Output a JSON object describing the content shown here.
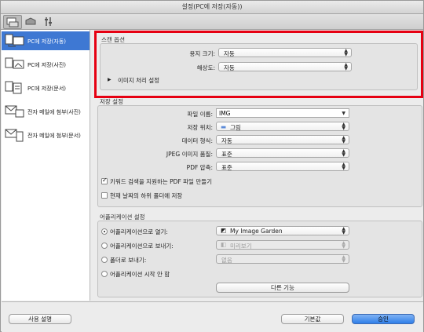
{
  "window": {
    "title": "설정(PC에 저장(자동))"
  },
  "toolbar": {
    "buttons": [
      "scan-from-computer-icon",
      "scan-from-panel-icon",
      "general-settings-icon"
    ]
  },
  "sidebar": {
    "items": [
      {
        "label": "PC에 저장(자동)",
        "icon": "save-auto-icon",
        "selected": true
      },
      {
        "label": "PC에 저장(사진)",
        "icon": "save-photo-icon"
      },
      {
        "label": "PC에 저장(문서)",
        "icon": "save-document-icon"
      },
      {
        "label": "전자 메일에 첨부(사진)",
        "icon": "email-photo-icon"
      },
      {
        "label": "전자 메일에 첨부(문서)",
        "icon": "email-document-icon"
      }
    ]
  },
  "scan_options": {
    "title": "스캔 옵션",
    "paper_size_label": "용지 크기:",
    "paper_size_value": "자동",
    "resolution_label": "해상도:",
    "resolution_value": "자동",
    "image_processing_label": "이미지 처리 설정"
  },
  "save_settings": {
    "title": "저장 설정",
    "file_name_label": "파일 이름:",
    "file_name_value": "IMG",
    "save_in_label": "저장 위치:",
    "save_in_value": "그림",
    "data_format_label": "데이터 형식:",
    "data_format_value": "자동",
    "jpeg_quality_label": "JPEG 이미지 품질:",
    "jpeg_quality_value": "표준",
    "pdf_compression_label": "PDF 압축:",
    "pdf_compression_value": "표준",
    "keyword_pdf_label": "키워드 검색을 지원하는 PDF 파일 만들기",
    "keyword_pdf_checked": true,
    "subfolder_label": "현재 날짜의 하위 폴더에 저장",
    "subfolder_checked": false
  },
  "app_settings": {
    "title": "어플리케이션 설정",
    "open_with_label": "어플리케이션으로 열기:",
    "open_with_value": "My Image Garden",
    "send_to_app_label": "어플리케이션으로 보내기:",
    "send_to_app_value": "미리보기",
    "send_to_folder_label": "폴더로 보내기:",
    "send_to_folder_value": "없음",
    "do_not_start_label": "어플리케이션 시작 안 함",
    "more_functions_label": "다른 기능",
    "selected": "open_with"
  },
  "footer": {
    "help_label": "사용 설명",
    "defaults_label": "기본값",
    "ok_label": "승인"
  },
  "colors": {
    "accent": "#3e78d3",
    "highlight": "#e60012"
  }
}
